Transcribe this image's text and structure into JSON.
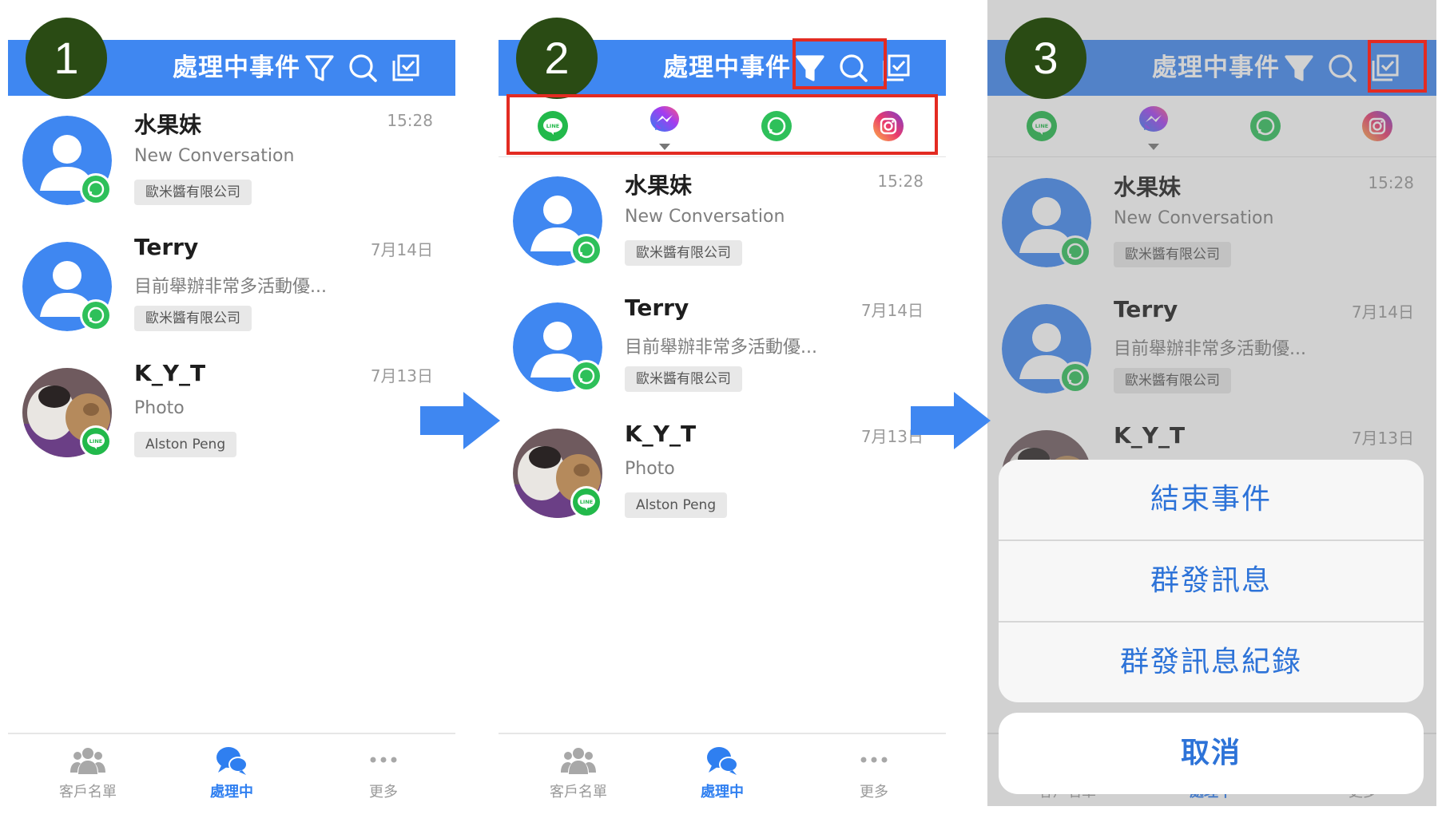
{
  "colors": {
    "header": "#3f87f1",
    "step_circle": "#2a4b14",
    "highlight": "#e32b22",
    "accent": "#2f7ff0",
    "arrow": "#3f87f1"
  },
  "header": {
    "title": "處理中事件"
  },
  "icons": {
    "filter": "filter-icon",
    "search": "search-icon",
    "batch": "checkbox-list-icon"
  },
  "channels": [
    "line-icon",
    "messenger-icon",
    "whatsapp-icon",
    "instagram-icon"
  ],
  "conversations": [
    {
      "name": "水果妹",
      "time": "15:28",
      "preview": "New Conversation",
      "tag": "歐米醬有限公司",
      "channel": "whatsapp",
      "avatar": "default"
    },
    {
      "name": "Terry",
      "time": "7月14日",
      "preview": "目前舉辦非常多活動優...",
      "tag": "歐米醬有限公司",
      "channel": "whatsapp",
      "avatar": "default"
    },
    {
      "name": "K_Y_T",
      "time": "7月13日",
      "preview": "Photo",
      "tag": "Alston Peng",
      "channel": "line",
      "avatar": "photo"
    }
  ],
  "tabs": [
    {
      "label": "客戶名單",
      "icon": "people-icon"
    },
    {
      "label": "處理中",
      "icon": "chat-bubbles-icon"
    },
    {
      "label": "更多",
      "icon": "more-dots-icon"
    }
  ],
  "steps": [
    "1",
    "2",
    "3"
  ],
  "action_sheet": {
    "items": [
      "結束事件",
      "群發訊息",
      "群發訊息紀錄"
    ],
    "cancel": "取消"
  }
}
